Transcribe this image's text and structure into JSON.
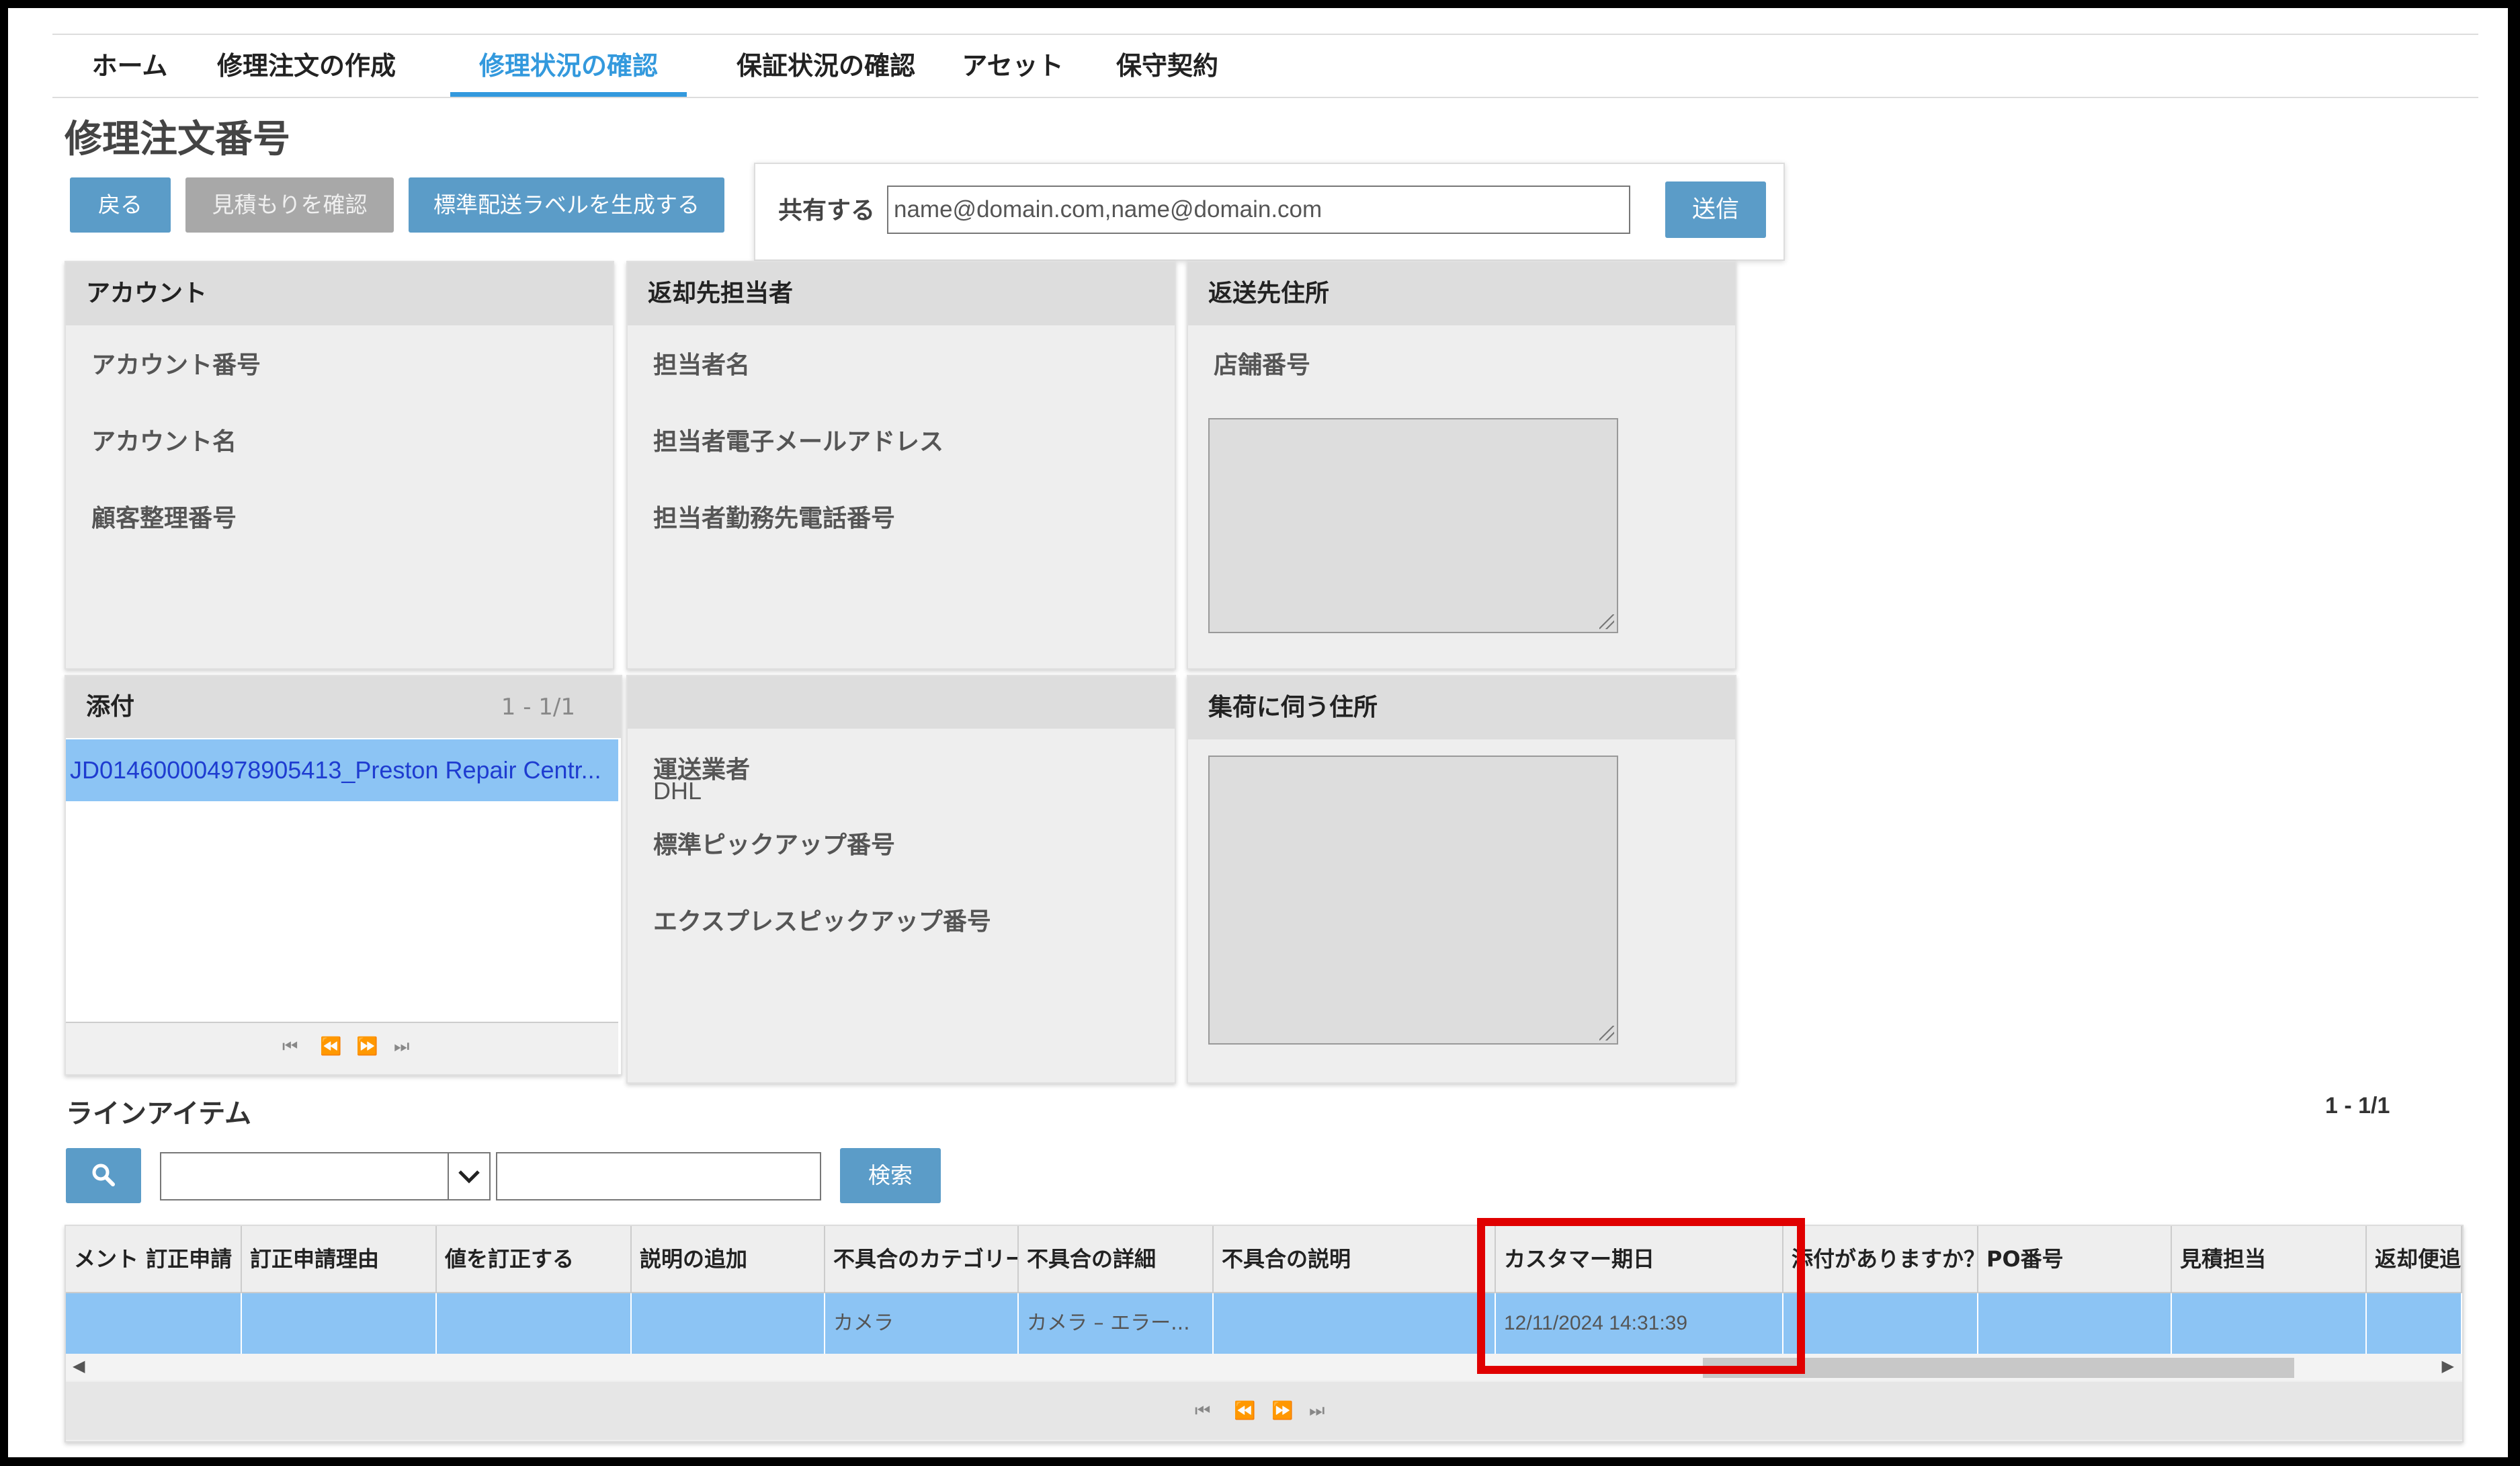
{
  "tabs": [
    "ホーム",
    "修理注文の作成",
    "修理状況の確認",
    "保証状況の確認",
    "アセット",
    "保守契約"
  ],
  "page_title": "修理注文番号",
  "buttons": {
    "back": "戻る",
    "quote": "見積もりを確認",
    "label": "標準配送ラベルを生成する"
  },
  "share": {
    "label": "共有する",
    "placeholder": "name@domain.com,name@domain.com",
    "send": "送信"
  },
  "account": {
    "title": "アカウント",
    "number": "アカウント番号",
    "name": "アカウント名",
    "customer_ref": "顧客整理番号"
  },
  "return_contact": {
    "title": "返却先担当者",
    "name": "担当者名",
    "email": "担当者電子メールアドレス",
    "phone": "担当者勤務先電話番号"
  },
  "return_address": {
    "title": "返送先住所",
    "store": "店舗番号"
  },
  "attachments": {
    "title": "添付",
    "count": "1 - 1/1",
    "file": "JD014600004978905413_Preston Repair Centr..."
  },
  "shipping": {
    "carrier_label": "運送業者",
    "carrier_value": "DHL",
    "std_pickup": "標準ピックアップ番号",
    "exp_pickup": "エクスプレスピックアップ番号"
  },
  "pickup_address": {
    "title": "集荷に伺う住所"
  },
  "line_items": {
    "title": "ラインアイテム",
    "count": "1 - 1/1",
    "search_btn": "検索",
    "columns": [
      "メント 訂正申請",
      "訂正申請理由",
      "値を訂正する",
      "説明の追加",
      "不具合のカテゴリー",
      "不具合の詳細",
      "不具合の説明",
      "カスタマー期日",
      "添付がありますか？",
      "PO番号",
      "見積担当",
      "返却便追"
    ],
    "row": [
      "",
      "",
      "",
      "",
      "カメラ",
      "カメラ – エラー...",
      "",
      "12/11/2024 14:31:39",
      "",
      "",
      "",
      ""
    ]
  },
  "highlight_color": "#e00000"
}
